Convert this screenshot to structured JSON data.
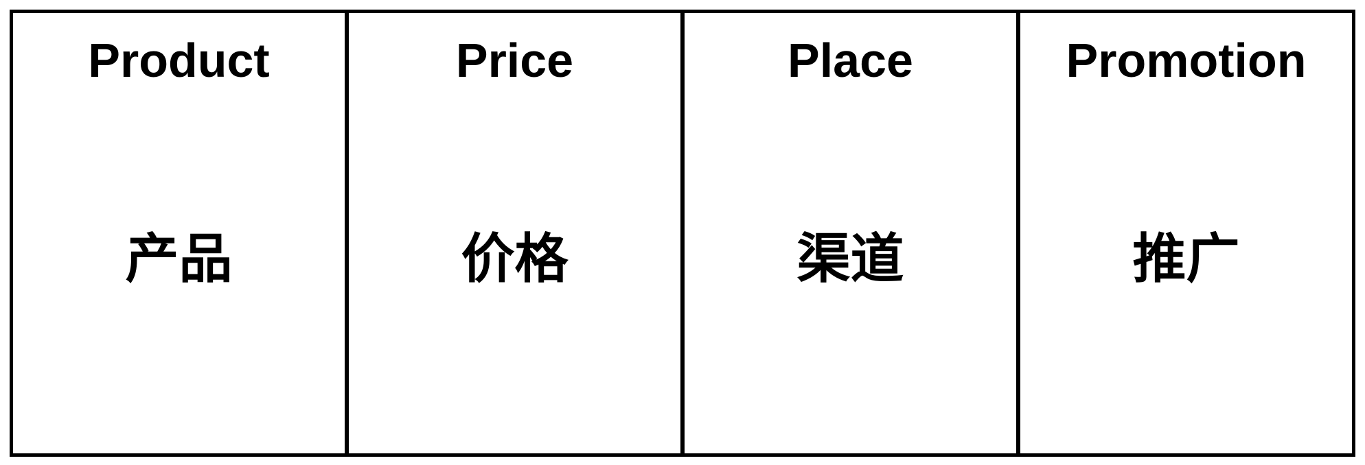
{
  "cells": [
    {
      "en": "Product",
      "zh": "产品"
    },
    {
      "en": "Price",
      "zh": "价格"
    },
    {
      "en": "Place",
      "zh": "渠道"
    },
    {
      "en": "Promotion",
      "zh": "推广"
    }
  ],
  "colors": {
    "border": "#000000",
    "text": "#000000",
    "background": "#ffffff"
  }
}
